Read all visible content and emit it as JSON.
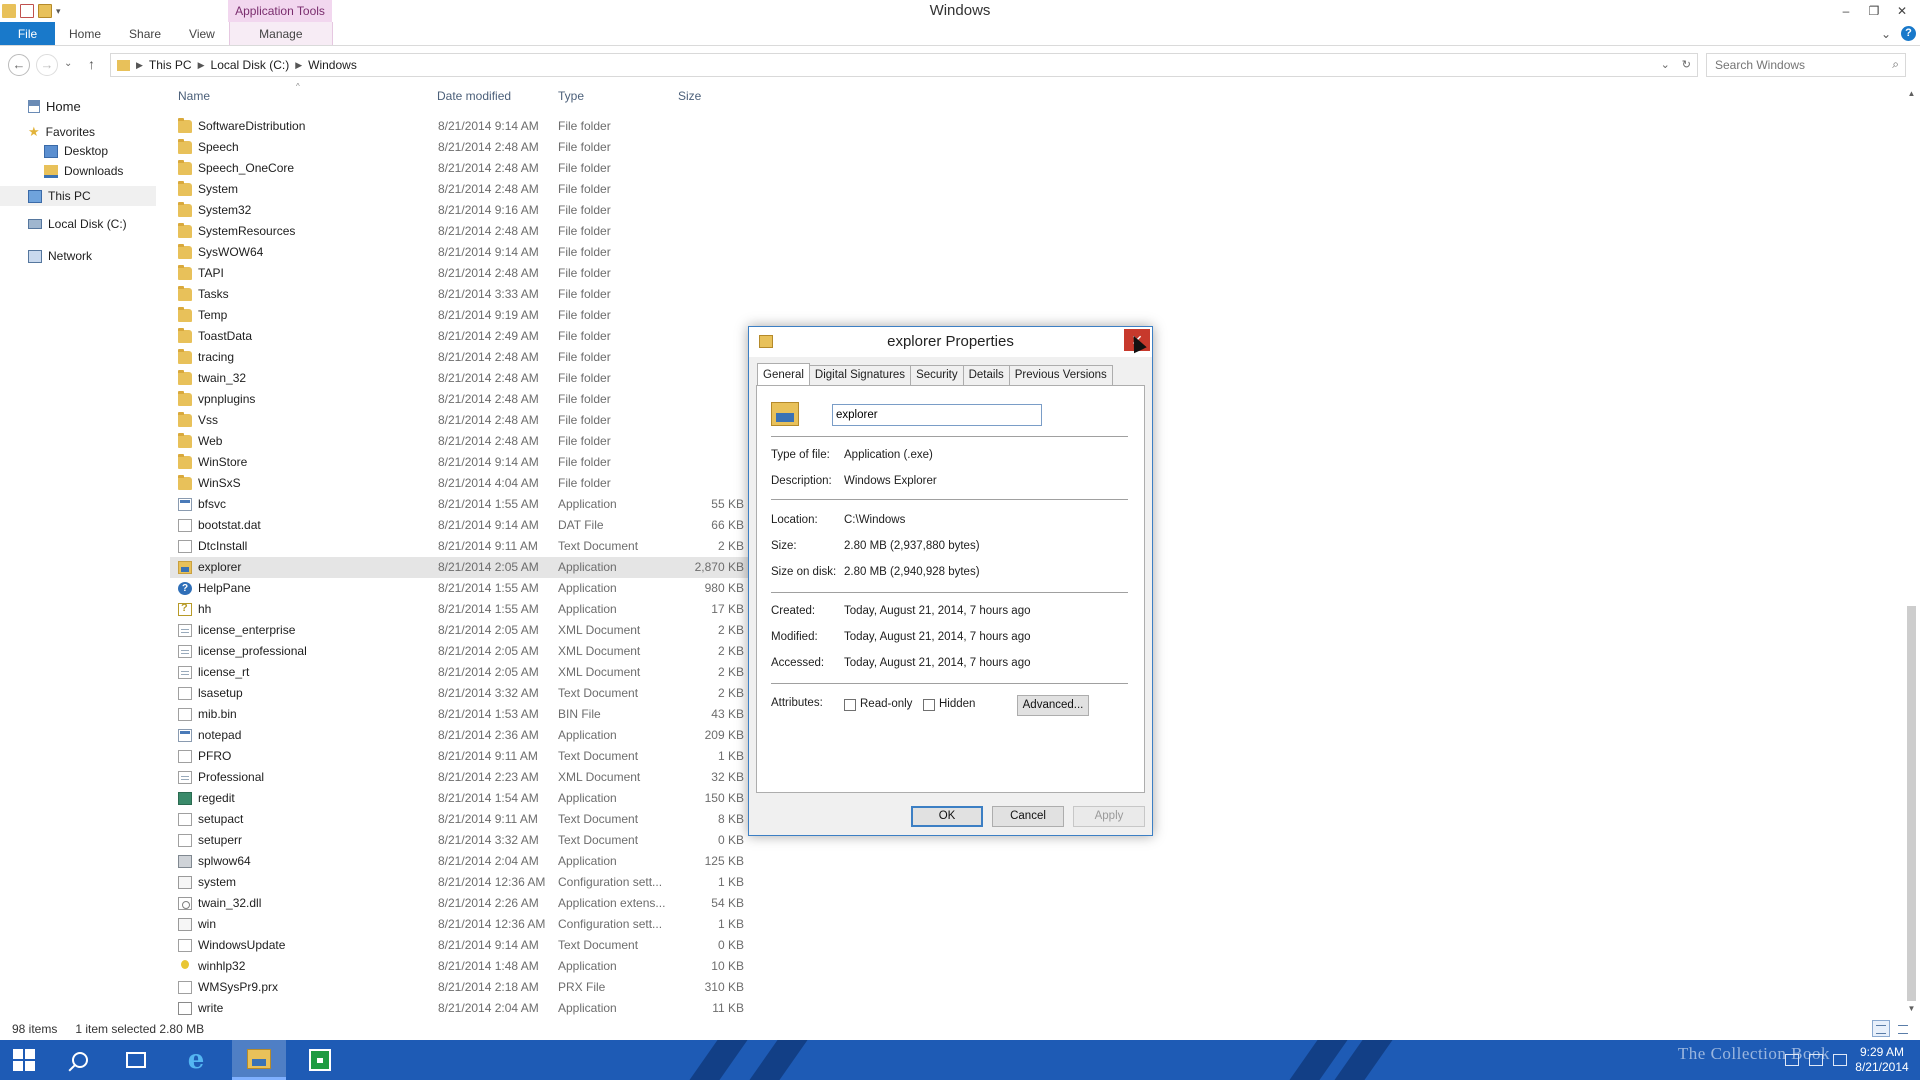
{
  "window": {
    "title": "Windows",
    "contextual_group": "Application Tools",
    "minimize": "–",
    "restore": "❐",
    "close": "✕"
  },
  "ribbon": {
    "tabs": [
      "File",
      "Home",
      "Share",
      "View",
      "Manage"
    ],
    "help": "?",
    "collapse": "⌄"
  },
  "address": {
    "back": "←",
    "forward": "→",
    "recent": "⌄",
    "up": "↑",
    "crumbs": [
      "This PC",
      "Local Disk (C:)",
      "Windows"
    ],
    "dropdown": "⌄",
    "refresh": "↻",
    "search_placeholder": "Search Windows",
    "search_glyph": "⌕"
  },
  "nav": {
    "home": "Home",
    "favorites": "Favorites",
    "desktop": "Desktop",
    "downloads": "Downloads",
    "thispc": "This PC",
    "localdisk": "Local Disk (C:)",
    "network": "Network"
  },
  "columns": {
    "name": "Name",
    "date": "Date modified",
    "type": "Type",
    "size": "Size",
    "sort_glyph": "^"
  },
  "files": [
    {
      "name": "SoftwareDistribution",
      "date": "8/21/2014 9:14 AM",
      "type": "File folder",
      "size": "",
      "icon": "folder"
    },
    {
      "name": "Speech",
      "date": "8/21/2014 2:48 AM",
      "type": "File folder",
      "size": "",
      "icon": "folder"
    },
    {
      "name": "Speech_OneCore",
      "date": "8/21/2014 2:48 AM",
      "type": "File folder",
      "size": "",
      "icon": "folder"
    },
    {
      "name": "System",
      "date": "8/21/2014 2:48 AM",
      "type": "File folder",
      "size": "",
      "icon": "folder"
    },
    {
      "name": "System32",
      "date": "8/21/2014 9:16 AM",
      "type": "File folder",
      "size": "",
      "icon": "folder"
    },
    {
      "name": "SystemResources",
      "date": "8/21/2014 2:48 AM",
      "type": "File folder",
      "size": "",
      "icon": "folder"
    },
    {
      "name": "SysWOW64",
      "date": "8/21/2014 9:14 AM",
      "type": "File folder",
      "size": "",
      "icon": "folder"
    },
    {
      "name": "TAPI",
      "date": "8/21/2014 2:48 AM",
      "type": "File folder",
      "size": "",
      "icon": "folder"
    },
    {
      "name": "Tasks",
      "date": "8/21/2014 3:33 AM",
      "type": "File folder",
      "size": "",
      "icon": "folder"
    },
    {
      "name": "Temp",
      "date": "8/21/2014 9:19 AM",
      "type": "File folder",
      "size": "",
      "icon": "folder"
    },
    {
      "name": "ToastData",
      "date": "8/21/2014 2:49 AM",
      "type": "File folder",
      "size": "",
      "icon": "folder"
    },
    {
      "name": "tracing",
      "date": "8/21/2014 2:48 AM",
      "type": "File folder",
      "size": "",
      "icon": "folder"
    },
    {
      "name": "twain_32",
      "date": "8/21/2014 2:48 AM",
      "type": "File folder",
      "size": "",
      "icon": "folder"
    },
    {
      "name": "vpnplugins",
      "date": "8/21/2014 2:48 AM",
      "type": "File folder",
      "size": "",
      "icon": "folder"
    },
    {
      "name": "Vss",
      "date": "8/21/2014 2:48 AM",
      "type": "File folder",
      "size": "",
      "icon": "folder"
    },
    {
      "name": "Web",
      "date": "8/21/2014 2:48 AM",
      "type": "File folder",
      "size": "",
      "icon": "folder"
    },
    {
      "name": "WinStore",
      "date": "8/21/2014 9:14 AM",
      "type": "File folder",
      "size": "",
      "icon": "folder"
    },
    {
      "name": "WinSxS",
      "date": "8/21/2014 4:04 AM",
      "type": "File folder",
      "size": "",
      "icon": "folder"
    },
    {
      "name": "bfsvc",
      "date": "8/21/2014 1:55 AM",
      "type": "Application",
      "size": "55 KB",
      "icon": "app"
    },
    {
      "name": "bootstat.dat",
      "date": "8/21/2014 9:14 AM",
      "type": "DAT File",
      "size": "66 KB",
      "icon": "doc"
    },
    {
      "name": "DtcInstall",
      "date": "8/21/2014 9:11 AM",
      "type": "Text Document",
      "size": "2 KB",
      "icon": "doc"
    },
    {
      "name": "explorer",
      "date": "8/21/2014 2:05 AM",
      "type": "Application",
      "size": "2,870 KB",
      "icon": "explorer",
      "selected": true
    },
    {
      "name": "HelpPane",
      "date": "8/21/2014 1:55 AM",
      "type": "Application",
      "size": "980 KB",
      "icon": "help"
    },
    {
      "name": "hh",
      "date": "8/21/2014 1:55 AM",
      "type": "Application",
      "size": "17 KB",
      "icon": "chm"
    },
    {
      "name": "license_enterprise",
      "date": "8/21/2014 2:05 AM",
      "type": "XML Document",
      "size": "2 KB",
      "icon": "xml"
    },
    {
      "name": "license_professional",
      "date": "8/21/2014 2:05 AM",
      "type": "XML Document",
      "size": "2 KB",
      "icon": "xml"
    },
    {
      "name": "license_rt",
      "date": "8/21/2014 2:05 AM",
      "type": "XML Document",
      "size": "2 KB",
      "icon": "xml"
    },
    {
      "name": "lsasetup",
      "date": "8/21/2014 3:32 AM",
      "type": "Text Document",
      "size": "2 KB",
      "icon": "doc"
    },
    {
      "name": "mib.bin",
      "date": "8/21/2014 1:53 AM",
      "type": "BIN File",
      "size": "43 KB",
      "icon": "doc"
    },
    {
      "name": "notepad",
      "date": "8/21/2014 2:36 AM",
      "type": "Application",
      "size": "209 KB",
      "icon": "app"
    },
    {
      "name": "PFRO",
      "date": "8/21/2014 9:11 AM",
      "type": "Text Document",
      "size": "1 KB",
      "icon": "doc"
    },
    {
      "name": "Professional",
      "date": "8/21/2014 2:23 AM",
      "type": "XML Document",
      "size": "32 KB",
      "icon": "xml"
    },
    {
      "name": "regedit",
      "date": "8/21/2014 1:54 AM",
      "type": "Application",
      "size": "150 KB",
      "icon": "regedit"
    },
    {
      "name": "setupact",
      "date": "8/21/2014 9:11 AM",
      "type": "Text Document",
      "size": "8 KB",
      "icon": "doc"
    },
    {
      "name": "setuperr",
      "date": "8/21/2014 3:32 AM",
      "type": "Text Document",
      "size": "0 KB",
      "icon": "doc"
    },
    {
      "name": "splwow64",
      "date": "8/21/2014 2:04 AM",
      "type": "Application",
      "size": "125 KB",
      "icon": "printer"
    },
    {
      "name": "system",
      "date": "8/21/2014 12:36 AM",
      "type": "Configuration sett...",
      "size": "1 KB",
      "icon": "cfg"
    },
    {
      "name": "twain_32.dll",
      "date": "8/21/2014 2:26 AM",
      "type": "Application extens...",
      "size": "54 KB",
      "icon": "dll"
    },
    {
      "name": "win",
      "date": "8/21/2014 12:36 AM",
      "type": "Configuration sett...",
      "size": "1 KB",
      "icon": "cfg"
    },
    {
      "name": "WindowsUpdate",
      "date": "8/21/2014 9:14 AM",
      "type": "Text Document",
      "size": "0 KB",
      "icon": "doc"
    },
    {
      "name": "winhlp32",
      "date": "8/21/2014 1:48 AM",
      "type": "Application",
      "size": "10 KB",
      "icon": "lamp"
    },
    {
      "name": "WMSysPr9.prx",
      "date": "8/21/2014 2:18 AM",
      "type": "PRX File",
      "size": "310 KB",
      "icon": "doc"
    },
    {
      "name": "write",
      "date": "8/21/2014 2:04 AM",
      "type": "Application",
      "size": "11 KB",
      "icon": "pen"
    }
  ],
  "status": {
    "count": "98 items",
    "selected": "1 item selected  2.80 MB"
  },
  "dialog": {
    "title": "explorer Properties",
    "close": "✕",
    "tabs": [
      "General",
      "Digital Signatures",
      "Security",
      "Details",
      "Previous Versions"
    ],
    "name_value": "explorer",
    "labels": {
      "type": "Type of file:",
      "description": "Description:",
      "location": "Location:",
      "size": "Size:",
      "size_on_disk": "Size on disk:",
      "created": "Created:",
      "modified": "Modified:",
      "accessed": "Accessed:",
      "attributes": "Attributes:"
    },
    "values": {
      "type": "Application (.exe)",
      "description": "Windows Explorer",
      "location": "C:\\Windows",
      "size": "2.80 MB (2,937,880 bytes)",
      "size_on_disk": "2.80 MB (2,940,928 bytes)",
      "created": "Today, August 21, 2014, 7 hours ago",
      "modified": "Today, August 21, 2014, 7 hours ago",
      "accessed": "Today, August 21, 2014, 7 hours ago"
    },
    "readonly": "Read-only",
    "hidden": "Hidden",
    "advanced": "Advanced...",
    "ok": "OK",
    "cancel": "Cancel",
    "apply": "Apply"
  },
  "taskbar": {
    "ie_glyph": "e",
    "watermark": "The Collection Book",
    "time": "9:29 AM",
    "date": "8/21/2014"
  },
  "colors": {
    "accent": "#1979ca",
    "taskbar": "#1e5bb5",
    "folder": "#e8c15a",
    "contextual": "#f2d7ef"
  }
}
